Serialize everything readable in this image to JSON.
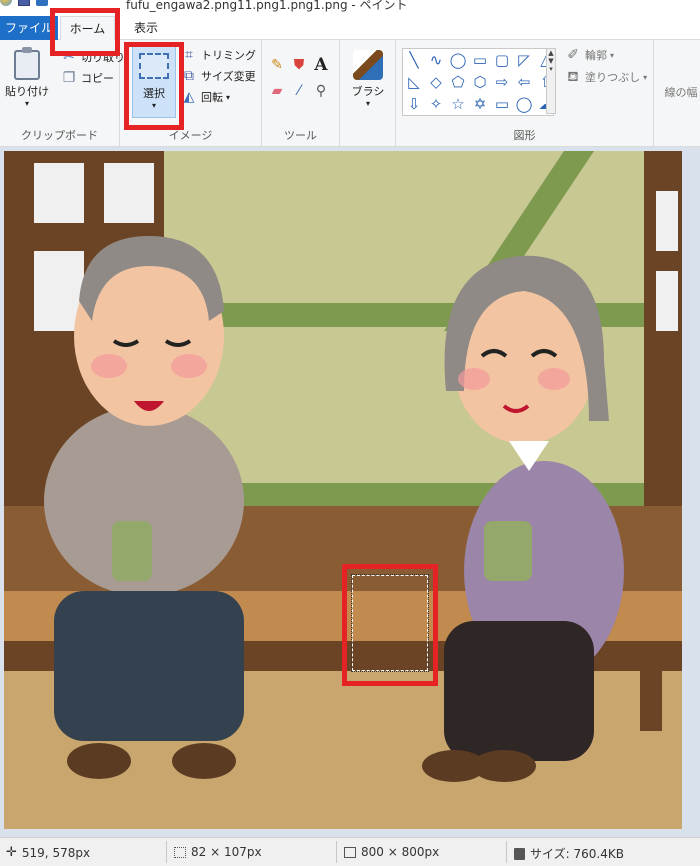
{
  "title_bar": {
    "title": "fufu_engawa2.png11.png1.png1.png - ペイント"
  },
  "tabs": [
    {
      "label": "ファイル"
    },
    {
      "label": "ホーム"
    },
    {
      "label": "表示"
    }
  ],
  "clipboard": {
    "paste_label": "貼り付け",
    "cut_label": "切り取り",
    "copy_label": "コピー",
    "group_label": "クリップボード"
  },
  "image": {
    "select_label": "選択",
    "trim_label": "トリミング",
    "resize_label": "サイズ変更",
    "rotate_label": "回転",
    "group_label": "イメージ"
  },
  "tools": {
    "group_label": "ツール",
    "icons": [
      "pencil-icon",
      "fill-icon",
      "text-icon",
      "eraser-icon",
      "color-picker-icon",
      "magnifier-icon"
    ]
  },
  "brush": {
    "label": "ブラシ"
  },
  "shapes": {
    "group_label": "図形",
    "outline_label": "輪郭",
    "fill_label": "塗りつぶし",
    "glyphs": [
      "╲",
      "∿",
      "◯",
      "▭",
      "▢",
      "◸",
      "△",
      "◺",
      "◇",
      "⬠",
      "⬡",
      "⇨",
      "⇦",
      "⇧",
      "⇩",
      "✧",
      "☆",
      "✡",
      "▭",
      "◯",
      "☁"
    ]
  },
  "line_width": {
    "label": "線の幅"
  },
  "status": {
    "cursor_pos": "519, 578px",
    "selection_size": "82 × 107px",
    "image_size": "800 × 800px",
    "file_size": "サイズ: 760.4KB"
  },
  "colors": {
    "file_tab": "#1e6fc7",
    "highlight": "#e52224",
    "canvas_bg": "#d8e1ec"
  }
}
